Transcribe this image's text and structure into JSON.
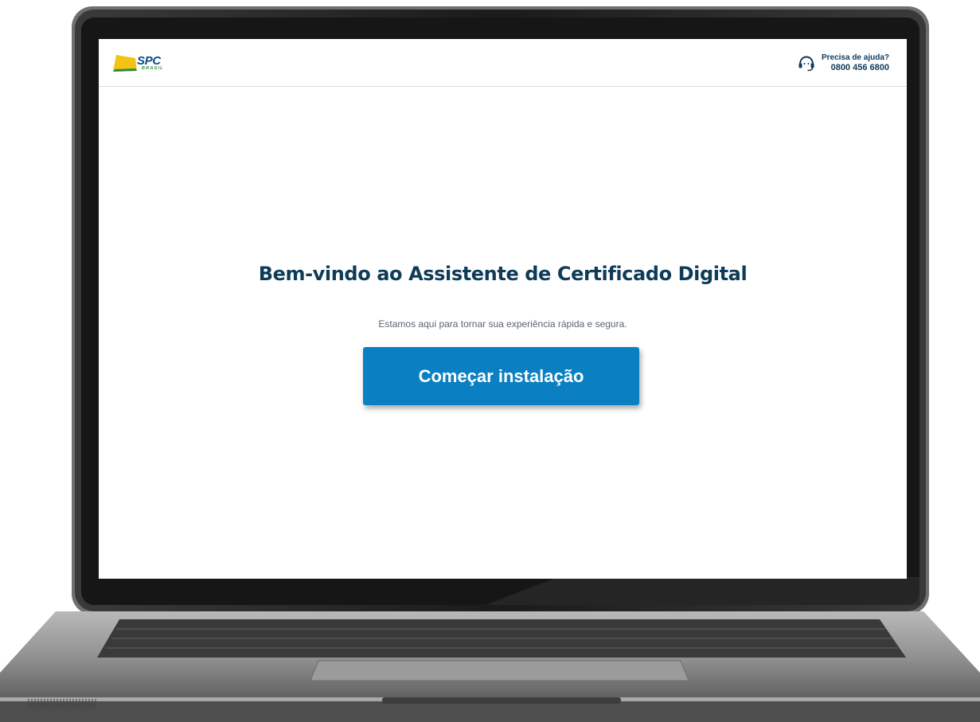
{
  "header": {
    "logo": {
      "name": "SPC",
      "subtitle": "BRASIL",
      "icon": "spc-brasil-logo-mark"
    },
    "help": {
      "label": "Precisa de ajuda?",
      "phone": "0800 456 6800",
      "icon": "headset-icon"
    }
  },
  "main": {
    "title": "Bem-vindo ao Assistente de Certificado Digital",
    "subtitle": "Estamos aqui para tornar sua experiência rápida e segura.",
    "start_button_label": "Começar instalação"
  },
  "colors": {
    "title": "#0e3b57",
    "button": "#0a7fc1",
    "logo_yellow": "#f2c314",
    "logo_blue": "#0a4d8a",
    "logo_green": "#2e8b3d"
  }
}
